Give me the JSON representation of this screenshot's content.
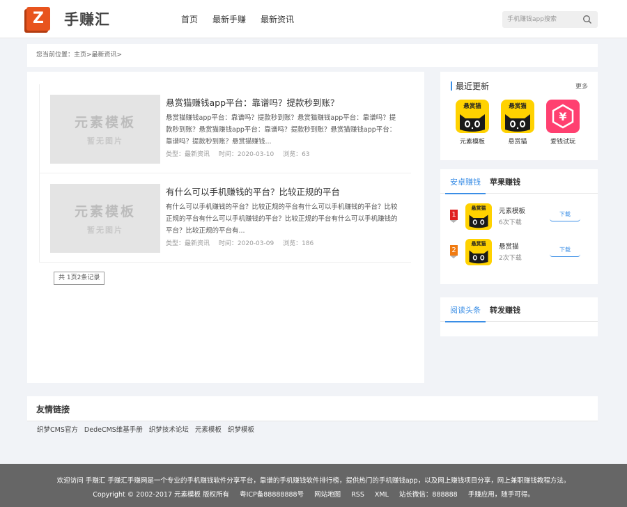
{
  "header": {
    "logo_letter": "Z",
    "site_name": "手赚汇",
    "nav": [
      "首页",
      "最新手赚",
      "最新资讯"
    ],
    "search_placeholder": "手机赚钱app搜索"
  },
  "breadcrumb": "您当前位置：主页>最新资讯>",
  "articles": [
    {
      "thumb_main": "元素模板",
      "thumb_sub": "暂无图片",
      "title": "悬赏猫赚钱app平台：靠谱吗？提款秒到账？",
      "desc": "悬赏猫赚钱app平台：靠谱吗？提款秒到账？悬赏猫赚钱app平台：靠谱吗？提款秒到账？悬赏猫赚钱app平台：靠谱吗？提款秒到账？悬赏猫赚钱app平台：靠谱吗？提款秒到账？悬赏猫赚钱...",
      "type": "类型：最新资讯",
      "time": "时间：2020-03-10",
      "views": "浏览：63"
    },
    {
      "thumb_main": "元素模板",
      "thumb_sub": "暂无图片",
      "title": "有什么可以手机赚钱的平台？比较正规的平台",
      "desc": "有什么可以手机赚钱的平台？比较正规的平台有什么可以手机赚钱的平台？比较正规的平台有什么可以手机赚钱的平台？比较正规的平台有什么可以手机赚钱的平台？比较正规的平台有...",
      "type": "类型：最新资讯",
      "time": "时间：2020-03-09",
      "views": "浏览：186"
    }
  ],
  "pager": "共 1页2条记录",
  "recent": {
    "title": "最近更新",
    "more": "更多",
    "apps": [
      {
        "name": "元素模板",
        "icon_label": "悬赏猫",
        "icon": "cat-icon"
      },
      {
        "name": "悬赏猫",
        "icon_label": "悬赏猫",
        "icon": "cat-icon"
      },
      {
        "name": "爱钱试玩",
        "icon_label": "",
        "icon": "yen-icon"
      }
    ]
  },
  "rank_box": {
    "tabs": [
      "安卓赚钱",
      "苹果赚钱"
    ],
    "items": [
      {
        "num": "1",
        "name": "元素模板",
        "sub": "6次下载",
        "icon_label": "悬赏猫",
        "button": "下载",
        "color": "#e02020"
      },
      {
        "num": "2",
        "name": "悬赏猫",
        "sub": "2次下载",
        "icon_label": "悬赏猫",
        "button": "下载",
        "color": "#f07a10"
      }
    ]
  },
  "read_box": {
    "tabs": [
      "阅读头条",
      "转发赚钱"
    ]
  },
  "friends": {
    "title": "友情链接",
    "links": [
      "织梦CMS官方",
      "DedeCMS维基手册",
      "织梦技术论坛",
      "元素模板",
      "织梦模板"
    ]
  },
  "footer": {
    "line1": "欢迎访问 手赚汇     手赚汇手赚网是一个专业的手机赚钱软件分享平台，靠谱的手机赚钱软件排行榜，提供热门的手机赚钱app，以及网上赚钱项目分享，网上兼职赚钱教程方法。",
    "line2": [
      "Copyright © 2002-2017 元素模板 版权所有",
      "粤ICP备88888888号",
      "网站地图",
      "RSS",
      "XML",
      "站长微信：888888",
      "手赚应用，随手可得。"
    ]
  },
  "colors": {
    "accent": "#3a8ee6",
    "logo": "#e8541e",
    "footer_bg": "#666666"
  }
}
